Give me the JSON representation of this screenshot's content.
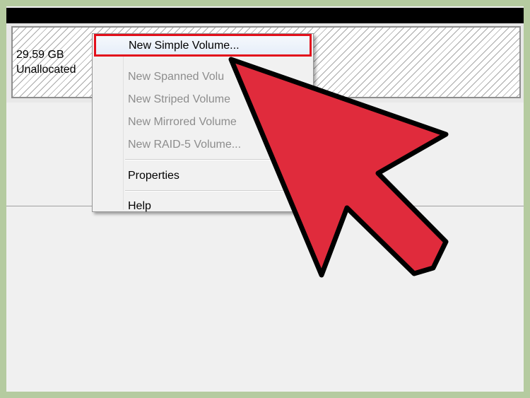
{
  "disk": {
    "size": "29.59 GB",
    "status": "Unallocated"
  },
  "context_menu": {
    "items": [
      {
        "label": "New Simple Volume...",
        "enabled": true,
        "highlighted": true
      },
      {
        "label": "New Spanned Volu",
        "enabled": false
      },
      {
        "label": "New Striped Volume",
        "enabled": false
      },
      {
        "label": "New Mirrored Volume",
        "enabled": false
      },
      {
        "label": "New RAID-5 Volume...",
        "enabled": false
      },
      {
        "label": "Properties",
        "enabled": true
      },
      {
        "label": "Help",
        "enabled": true
      }
    ]
  },
  "colors": {
    "frame_border": "#b5cba0",
    "highlight_box": "#e3101c",
    "arrow_fill": "#e02b3c",
    "arrow_outline": "#000000"
  },
  "icons": {
    "pointer": "red-arrow-pointer-icon"
  }
}
